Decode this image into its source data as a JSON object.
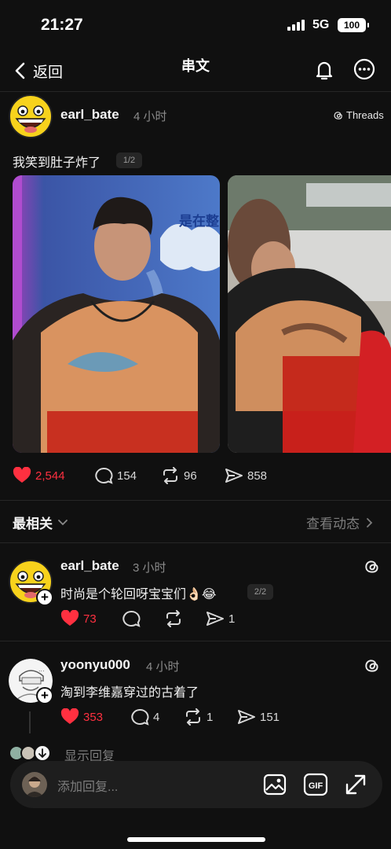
{
  "status_bar": {
    "time": "21:27",
    "network": "5G",
    "battery": "100"
  },
  "nav": {
    "back_label": "返回",
    "title": "串文",
    "icons": [
      "chevron-left-icon",
      "bell-icon",
      "more-icon"
    ]
  },
  "post": {
    "username": "earl_bate",
    "time_ago": "4 小时",
    "source_label": "Threads",
    "text": "我笑到肚子炸了",
    "page_indicator": "1/2",
    "image_overlay_text": "是在整",
    "stats": {
      "likes": "2,544",
      "comments": "154",
      "reposts": "96",
      "shares": "858"
    },
    "liked": true
  },
  "comments_header": {
    "sort_label": "最相关",
    "activity_label": "查看动态"
  },
  "comments": [
    {
      "username": "earl_bate",
      "time_ago": "3 小时",
      "text": "时尚是个轮回呀宝宝们👌🏻😂",
      "page_indicator": "2/2",
      "likes": "73",
      "comments": "",
      "reposts": "",
      "shares": "1"
    },
    {
      "username": "yoonyu000",
      "time_ago": "4 小时",
      "text": "淘到李维嘉穿过的古着了",
      "likes": "353",
      "comments": "4",
      "reposts": "1",
      "shares": "151"
    }
  ],
  "show_replies_label": "显示回复",
  "composer": {
    "placeholder": "添加回复...",
    "icons": [
      "image-icon",
      "gif-icon",
      "expand-icon"
    ]
  },
  "colors": {
    "background": "#101010",
    "like_red": "#ff3040",
    "muted_text": "#8a8a8a"
  }
}
